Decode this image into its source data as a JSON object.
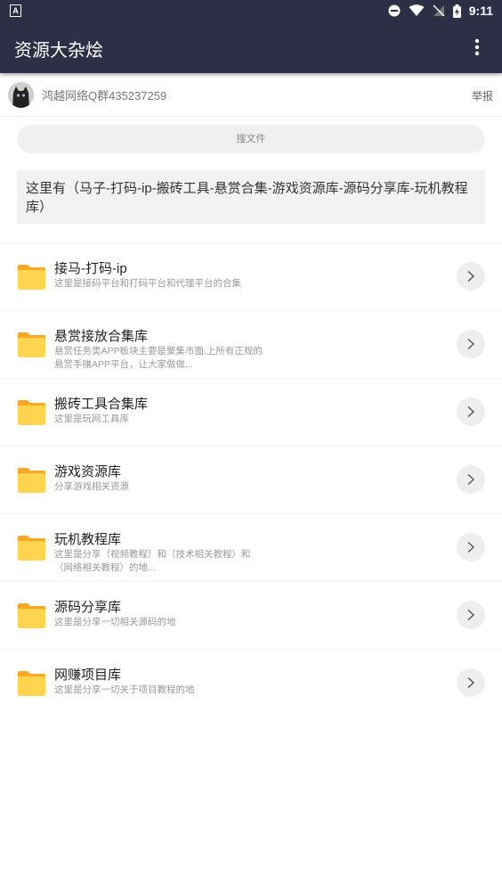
{
  "status_bar": {
    "time": "9:11"
  },
  "app_bar": {
    "title": "资源大杂烩"
  },
  "owner": {
    "name": "鸿越网络Q群435237259",
    "report": "举报"
  },
  "search": {
    "label": "搜文件"
  },
  "description": "这里有（马子-打码-ip-搬砖工具-悬赏合集-游戏资源库-源码分享库-玩机教程库）",
  "folders": [
    {
      "name": "接马-打码-ip",
      "sub": "这里是接码平台和打码平台和代理平台的合集"
    },
    {
      "name": "悬赏接放合集库",
      "sub": "悬赏任务类APP板块主要是聚集市面.上所有正规的悬赏手赚APP平台，让大家做做..."
    },
    {
      "name": "搬砖工具合集库",
      "sub": "这里是玩网工具库"
    },
    {
      "name": "游戏资源库",
      "sub": "分享游戏相关资源"
    },
    {
      "name": "玩机教程库",
      "sub": "这里是分享（视频教程）和（技术相关教程）和（网络相关教程）的地..."
    },
    {
      "name": "源码分享库",
      "sub": "这里是分享一切相关源码的地"
    },
    {
      "name": "网赚项目库",
      "sub": "这里是分享一切关于项目教程的地"
    }
  ],
  "colors": {
    "app_bar": "#2c2f45",
    "folder": "#ffd54f",
    "folder_tab": "#f9a825"
  }
}
